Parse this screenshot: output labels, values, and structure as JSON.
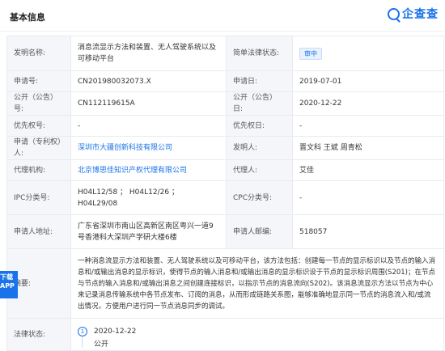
{
  "header": {
    "section_title": "基本信息",
    "logo_text": "企查查",
    "logo_icon": "magnifier-icon"
  },
  "rows": {
    "title_label": "发明名称:",
    "title_value": "消息流显示方法和装置、无人驾驶系统以及可移动平台",
    "legal_status_label": "简单法律状态:",
    "legal_status_value": "审中",
    "app_no_label": "申请号:",
    "app_no_value": "CN201980032073.X",
    "app_date_label": "申请日:",
    "app_date_value": "2019-07-01",
    "pub_no_label": "公开（公告）号:",
    "pub_no_value": "CN112119615A",
    "pub_date_label": "公开（公告）日:",
    "pub_date_value": "2020-12-22",
    "priority_label": "优先权号:",
    "priority_value": "-",
    "priority_date_label": "优先权日:",
    "priority_date_value": "-",
    "applicant_label": "申请（专利权）人:",
    "applicant_value": "深圳市大疆创新科技有限公司",
    "inventor_label": "发明人:",
    "inventor_value": "晋文科 王斌 周青松",
    "agency_label": "代理机构:",
    "agency_value": "北京博思佳知识产权代理有限公司",
    "agent_label": "代理人:",
    "agent_value": "艾佳",
    "ipc_label": "IPC分类号:",
    "ipc_value": "H04L12/58 ； H04L12/26 ； H04L29/08",
    "cpc_label": "CPC分类号:",
    "cpc_value": "-",
    "address_label": "申请人地址:",
    "address_value": "广东省深圳市南山区高新区南区粤兴一道9号香港科大深圳产学研大楼6楼",
    "postcode_label": "申请人邮编:",
    "postcode_value": "518057",
    "abstract_label": "摘要:",
    "abstract_value": "一种消息流显示方法和装置、无人驾驶系统以及可移动平台，该方法包括：创建每一节点的显示标识以及节点的输入消息和/或输出消息的显示标识，使得节点的输入消息和/或输出消息的显示标识设于节点的显示标识周围(S201)；在节点与节点的输入消息和/或输出消息之间创建连接标识，以指示节点的消息流向(S202)。该消息流显示方法以节点为中心来记录消息传输系统中各节点发布、订阅的消息，从而形成链路关系图，能够准确地显示同一节点的消息流入和/或流出情况，方便用户进行同一节点消息同步的调试。",
    "legal_label": "法律状态:",
    "legal_date": "2020-12-22",
    "legal_event": "公开",
    "legal_step": "1"
  },
  "float_tab": {
    "line1": "下载",
    "line2": "APP"
  }
}
